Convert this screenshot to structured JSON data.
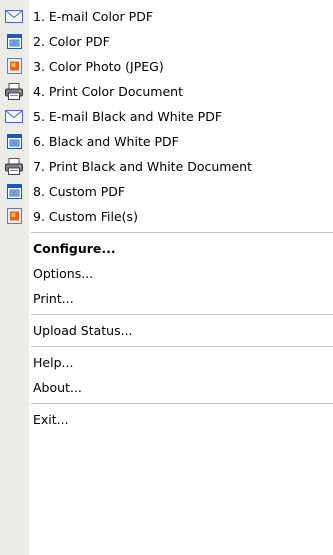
{
  "menu": {
    "items": [
      {
        "label": "1. E-mail Color PDF",
        "icon": "mail-envelope-icon"
      },
      {
        "label": "2. Color PDF",
        "icon": "pdf-document-icon"
      },
      {
        "label": "3. Color Photo (JPEG)",
        "icon": "photo-file-icon"
      },
      {
        "label": "4. Print Color Document",
        "icon": "printer-icon"
      },
      {
        "label": "5. E-mail Black and White PDF",
        "icon": "mail-envelope-icon"
      },
      {
        "label": "6. Black and White PDF",
        "icon": "pdf-document-icon"
      },
      {
        "label": "7. Print Black and White Document",
        "icon": "printer-icon"
      },
      {
        "label": "8. Custom PDF",
        "icon": "pdf-document-icon"
      },
      {
        "label": "9. Custom File(s)",
        "icon": "photo-file-icon"
      }
    ],
    "configure_label": "Configure...",
    "options_label": "Options...",
    "print_label": "Print...",
    "upload_status_label": "Upload Status...",
    "help_label": "Help...",
    "about_label": "About...",
    "exit_label": "Exit..."
  },
  "colors": {
    "gutter": "#ecebe6",
    "separator": "#c5c5c5",
    "mail_blue": "#3a6fd0",
    "pdf_blue": "#1f58b5",
    "photo_orange": "#e7651a"
  }
}
